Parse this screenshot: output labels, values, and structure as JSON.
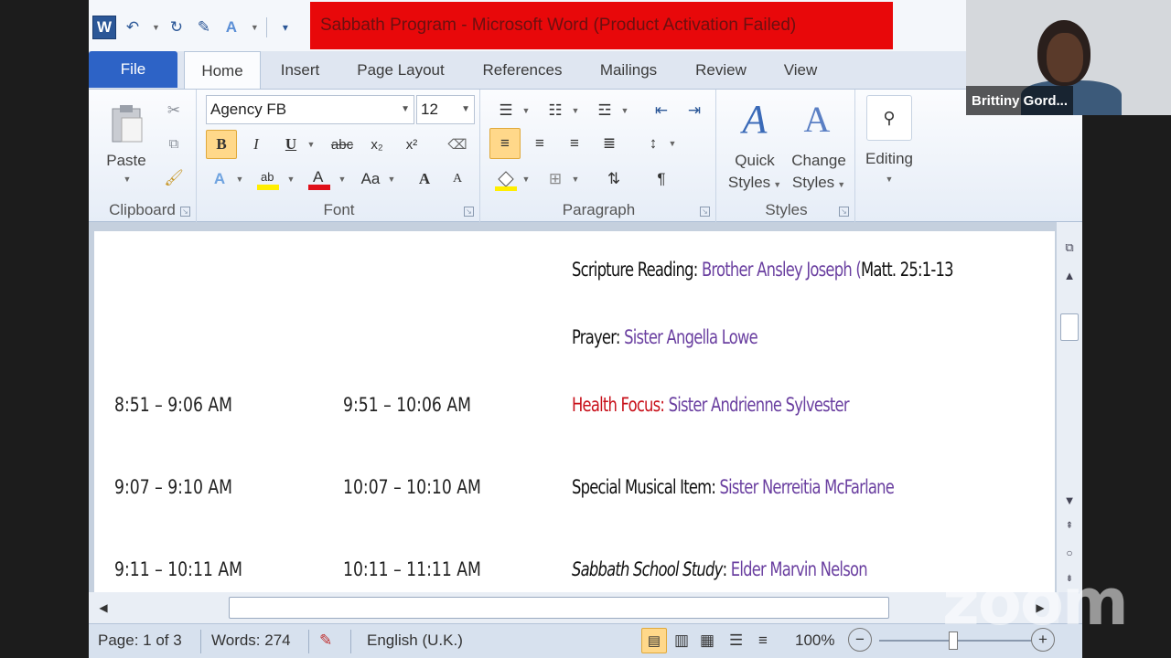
{
  "window": {
    "title": "Sabbath Program  -  Microsoft Word (Product Activation Failed)",
    "app_logo": "W"
  },
  "qat": {
    "icons": [
      "word-icon",
      "undo-icon",
      "redo-icon",
      "edit-icon",
      "text-effects-icon",
      "customize-icon"
    ]
  },
  "tabs": {
    "file": "File",
    "items": [
      "Home",
      "Insert",
      "Page Layout",
      "References",
      "Mailings",
      "Review",
      "View"
    ]
  },
  "ribbon": {
    "clipboard": {
      "label": "Clipboard",
      "paste": "Paste"
    },
    "font": {
      "label": "Font",
      "family": "Agency FB",
      "size": "12",
      "bold": "B",
      "italic": "I",
      "underline": "U",
      "strike": "abc",
      "subscript": "x₂",
      "superscript": "x²",
      "change_case": "Aa",
      "grow": "A",
      "shrink": "A"
    },
    "paragraph": {
      "label": "Paragraph",
      "pilcrow": "¶"
    },
    "styles": {
      "label": "Styles",
      "quick_styles": [
        "Quick",
        "Styles"
      ],
      "change_styles": [
        "Change",
        "Styles"
      ]
    },
    "editing": {
      "label": "Editing"
    }
  },
  "document": {
    "lines": [
      {
        "label": "Scripture Reading",
        "sep": ":",
        "name": "Brother Ansley Joseph (",
        "extra": "Matt. 25:1-13"
      },
      {
        "label": "Prayer",
        "sep": ":",
        "name": "Sister Angella Lowe"
      },
      {
        "time1": "8:51 – 9:06 AM",
        "time2": "9:51 – 10:06 AM",
        "label": "Health Focus",
        "sep": ":",
        "name": "Sister Andrienne Sylvester"
      },
      {
        "time1": "9:07 – 9:10 AM",
        "time2": "10:07 – 10:10 AM",
        "label": "Special Musical Item",
        "sep": ":",
        "name": "Sister Nerreitia McFarlane"
      },
      {
        "time1": "9:11 – 10:11 AM",
        "time2": "10:11 – 11:11 AM",
        "label": "Sabbath School Study",
        "sep": ":",
        "name": "Elder Marvin Nelson"
      }
    ]
  },
  "status": {
    "page": "Page: 1 of 3",
    "words": "Words: 274",
    "language": "English (U.K.)",
    "zoom": "100%"
  },
  "meeting": {
    "participant_name": "Brittiny Gord...",
    "watermark": "zoom"
  },
  "colors": {
    "title_banner": "#e8080a",
    "file_tab": "#2d63c6",
    "name_purple": "#6a3fa0",
    "health_red": "#c8101a"
  }
}
